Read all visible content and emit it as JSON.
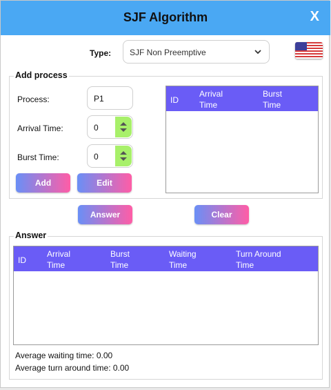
{
  "window": {
    "title": "SJF Algorithm",
    "close_label": "X"
  },
  "type_row": {
    "label": "Type:",
    "selected": "SJF Non Preemptive",
    "flag_icon": "us-flag-icon"
  },
  "add_process": {
    "group_title": "Add process",
    "process_label": "Process:",
    "process_value": "P1",
    "arrival_label": "Arrival Time:",
    "arrival_value": "0",
    "burst_label": "Burst Time:",
    "burst_value": "0",
    "add_button": "Add",
    "edit_button": "Edit",
    "table_headers": {
      "id": "ID",
      "arrival": "Arrival\nTime",
      "burst": "Burst\nTime"
    }
  },
  "actions": {
    "answer_button": "Answer",
    "clear_button": "Clear"
  },
  "answer": {
    "group_title": "Answer",
    "table_headers": {
      "id": "ID",
      "arrival": "Arrival\nTime",
      "burst": "Burst\nTime",
      "waiting": "Waiting\nTime",
      "turnaround": "Turn Around\nTime"
    },
    "avg_waiting": "Average waiting time: 0.00",
    "avg_turnaround": "Average turn around time: 0.00"
  },
  "colors": {
    "title_bar": "#4aa8f3",
    "table_header": "#6a5cf6",
    "button_gradient_start": "#6a8ff6",
    "button_gradient_end": "#ff5da6",
    "spinner": "#a8f06a"
  }
}
